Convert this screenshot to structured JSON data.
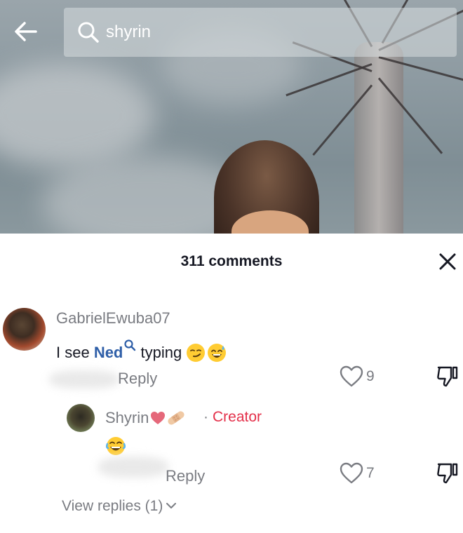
{
  "search": {
    "query": "shyrin"
  },
  "panel": {
    "title": "311 comments"
  },
  "comments": [
    {
      "username": "GabrielEwuba07",
      "text_before": "I see ",
      "mention": "Ned",
      "text_after": " typing ",
      "reply_label": "Reply",
      "likes": "9"
    }
  ],
  "reply": {
    "username": "Shyrin",
    "badge_separator": "·",
    "badge": "Creator",
    "reply_label": "Reply",
    "likes": "7"
  },
  "view_replies": "View replies (1)",
  "icons": [
    "back-arrow-icon",
    "search-icon",
    "close-icon",
    "heart-icon",
    "dislike-icon",
    "chevron-down-icon",
    "search-mention-icon",
    "heart-emoji-icon",
    "bandage-emoji-icon",
    "smirk-emoji-icon",
    "sweat-smile-emoji-icon",
    "laughing-emoji-icon"
  ],
  "colors": {
    "creator_badge": "#e4304a",
    "mention": "#2f5fa8",
    "secondary_text": "#7a7c82"
  }
}
